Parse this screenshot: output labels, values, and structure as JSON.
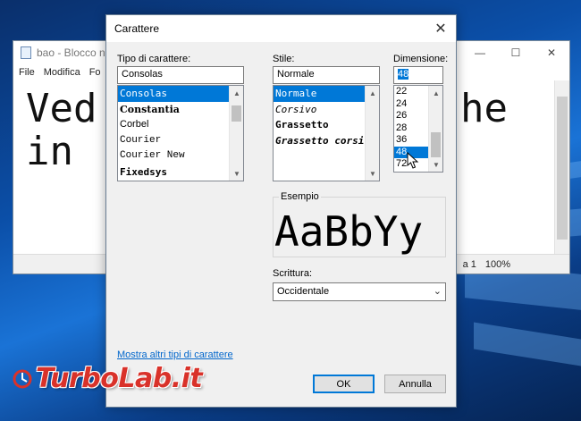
{
  "notepad": {
    "title": "bao - Blocco no",
    "menu": [
      "File",
      "Modifica",
      "Fo"
    ],
    "text_left": "Ved\nin",
    "text_right": "he",
    "status_position": "a 1",
    "status_zoom": "100%"
  },
  "dialog": {
    "title": "Carattere",
    "font_label": "Tipo di carattere:",
    "font_value": "Consolas",
    "fonts": [
      "Consolas",
      "Constantia",
      "Corbel",
      "Courier",
      "Courier New",
      "Fixedsys"
    ],
    "style_label": "Stile:",
    "style_value": "Normale",
    "styles": [
      "Normale",
      "Corsivo",
      "Grassetto",
      "Grassetto corsivo"
    ],
    "size_label": "Dimensione:",
    "size_value": "48",
    "sizes": [
      "22",
      "24",
      "26",
      "28",
      "36",
      "48",
      "72"
    ],
    "example_label": "Esempio",
    "example_text": "AaBbYy",
    "script_label": "Scrittura:",
    "script_value": "Occidentale",
    "more_fonts_link": "Mostra altri tipi di carattere",
    "ok_label": "OK",
    "cancel_label": "Annulla"
  },
  "watermark": {
    "text": "TurboLab.it"
  },
  "colors": {
    "selection": "#0078d7",
    "link": "#0066cc",
    "watermark": "#d9322a"
  }
}
